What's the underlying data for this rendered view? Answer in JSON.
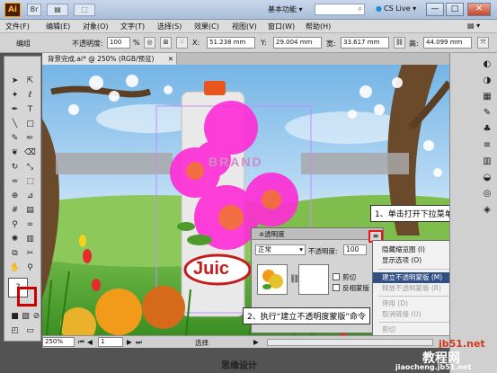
{
  "titlebar": {
    "app_logo": "Ai",
    "icons": [
      "Br",
      "▤",
      "▾",
      "⬚",
      "▾"
    ],
    "workspace_label": "基本功能 ▾",
    "cs_live": "CS Live ▾",
    "window_buttons": [
      "—",
      "□",
      "✕"
    ]
  },
  "menubar": {
    "items": [
      "文件(F)",
      "编辑(E)",
      "对象(O)",
      "文字(T)",
      "选择(S)",
      "效果(C)",
      "视图(V)",
      "窗口(W)",
      "帮助(H)"
    ],
    "right_icon": "▤ ▾"
  },
  "controlbar": {
    "edit_label": "编组",
    "opacity_label": "不透明度:",
    "opacity_value": "100",
    "opacity_unit": "%",
    "x_label": "X:",
    "x_value": "51.238 mm",
    "y_label": "Y:",
    "y_value": "29.004 mm",
    "w_label": "宽:",
    "w_value": "33.617 mm",
    "h_label": "高:",
    "h_value": "44.099 mm"
  },
  "document": {
    "tab_title": "背景完成.ai* @ 250% (RGB/预览)",
    "tab_close": "✕"
  },
  "transparency_panel": {
    "title": "≑透明度",
    "blend_mode": "正常",
    "opacity_label": "不透明度:",
    "opacity_value": "100",
    "clip_label": "剪切",
    "invert_label": "反相蒙版"
  },
  "panel_menu": {
    "items": [
      {
        "label": "隐藏缩览图 (I)",
        "state": "normal"
      },
      {
        "label": "显示选项 (O)",
        "state": "normal"
      },
      {
        "label": "建立不透明蒙版 (M)",
        "state": "selected"
      },
      {
        "label": "释放不透明蒙版 (R)",
        "state": "disabled"
      },
      {
        "label": "停用 (D)",
        "state": "disabled"
      },
      {
        "label": "取消链接 (U)",
        "state": "disabled"
      },
      {
        "label": "剪切",
        "state": "disabled"
      },
      {
        "label": "新建",
        "state": "disabled"
      }
    ]
  },
  "callouts": {
    "step1": "1、单击打开下拉菜单",
    "step2": "2、执行“建立不透明度蒙版”命令"
  },
  "statusbar": {
    "zoom": "250%",
    "page": "1",
    "mode": "选择"
  },
  "canvas": {
    "logo_text": "Juic",
    "brand_text": "BRAND"
  },
  "watermarks": {
    "left": "思缘设计",
    "right_top": "jb51.net",
    "right_mid": "教程网",
    "right_bottom": "jiaocheng.jb51.net"
  },
  "colors": {
    "magenta": "#ff2bd6",
    "selection": "#324f85",
    "highlight_red": "#e81818"
  }
}
